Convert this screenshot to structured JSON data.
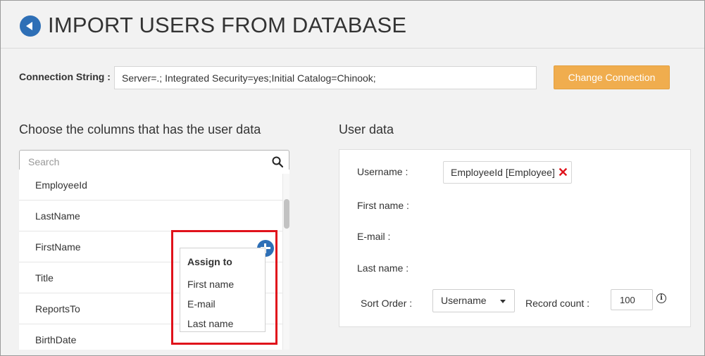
{
  "header": {
    "title": "IMPORT USERS FROM DATABASE",
    "back_icon": "back-arrow-icon"
  },
  "connection": {
    "label": "Connection String :",
    "value": "Server=.; Integrated Security=yes;Initial Catalog=Chinook;",
    "change_button": "Change Connection",
    "button_color": "#f0ad4e"
  },
  "columns": {
    "heading": "Choose the columns that has the user data",
    "search_placeholder": "Search",
    "items": [
      "EmployeeId",
      "LastName",
      "FirstName",
      "Title",
      "ReportsTo",
      "BirthDate"
    ]
  },
  "assign_menu": {
    "title": "Assign to",
    "options": [
      "First name",
      "E-mail",
      "Last name"
    ],
    "highlight_color": "#e0121b"
  },
  "user_data": {
    "heading": "User data",
    "username_label": "Username :",
    "username_value": "EmployeeId [Employee]",
    "first_name_label": "First name :",
    "email_label": "E-mail :",
    "last_name_label": "Last name :",
    "sort_order_label": "Sort Order :",
    "sort_order_value": "Username",
    "record_count_label": "Record count :",
    "record_count_value": "100",
    "remove_icon": "remove-x-icon",
    "info_icon": "info-icon"
  }
}
